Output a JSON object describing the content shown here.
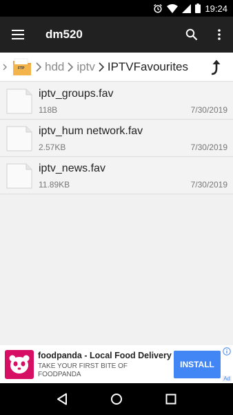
{
  "status_bar": {
    "time": "19:24",
    "icons": [
      "alarm-icon",
      "wifi-icon",
      "signal-icon",
      "battery-icon"
    ]
  },
  "app_bar": {
    "title": "dm520",
    "icons": [
      "menu-icon",
      "search-icon",
      "more-vert-icon"
    ]
  },
  "breadcrumb": {
    "items": [
      {
        "label": "hdd"
      },
      {
        "label": "iptv"
      },
      {
        "label": "IPTVFavourites"
      }
    ],
    "folder_badge": "FTP"
  },
  "files": [
    {
      "name": "iptv_groups.fav",
      "size": "118B",
      "date": "7/30/2019"
    },
    {
      "name": "iptv_hum network.fav",
      "size": "2.57KB",
      "date": "7/30/2019"
    },
    {
      "name": "iptv_news.fav",
      "size": "11.89KB",
      "date": "7/30/2019"
    }
  ],
  "ad": {
    "title": "foodpanda - Local Food Delivery",
    "description": "TAKE YOUR FIRST BITE OF FOODPANDA",
    "button": "INSTALL",
    "badge": "Ad",
    "brand_color": "#d70f64",
    "button_color": "#4285f4"
  },
  "nav_bar": {
    "icons": [
      "back-icon",
      "home-icon",
      "recents-icon"
    ]
  },
  "colors": {
    "app_bar": "#212121",
    "background": "#f1f1f1",
    "breadcrumb_bg": "#ffffff"
  }
}
